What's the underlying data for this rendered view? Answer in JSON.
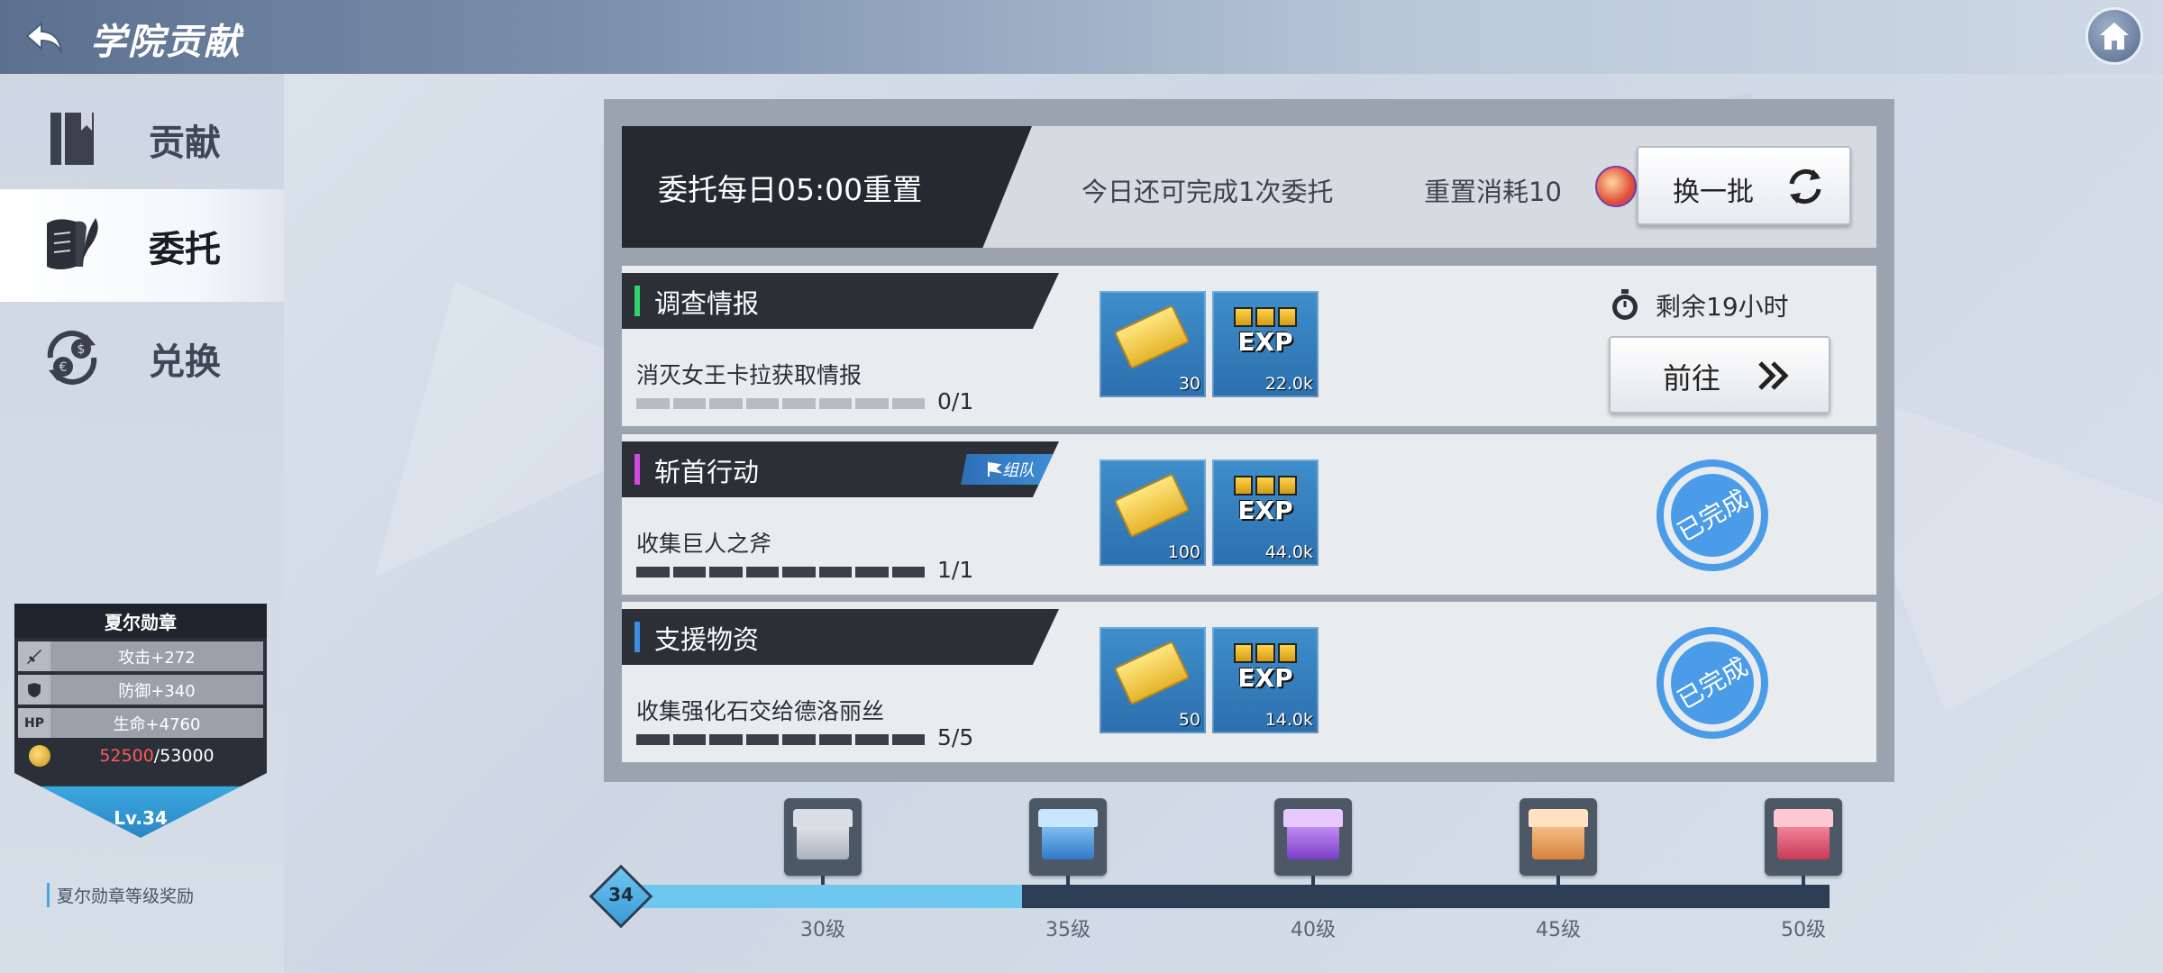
{
  "header": {
    "title": "学院贡献",
    "back_icon": "back-arrow-icon",
    "home_icon": "home-icon"
  },
  "sidebar": {
    "items": [
      {
        "label": "贡献",
        "icon": "book-icon",
        "active": false
      },
      {
        "label": "委托",
        "icon": "scroll-quill-icon",
        "active": true
      },
      {
        "label": "兑换",
        "icon": "currency-exchange-icon",
        "active": false
      }
    ]
  },
  "medal": {
    "title": "夏尔勋章",
    "stats": [
      {
        "icon": "sword-icon",
        "text": "攻击+272"
      },
      {
        "icon": "shield-icon",
        "text": "防御+340"
      },
      {
        "icon": "HP",
        "text": "生命+4760"
      }
    ],
    "coin_current": "52500",
    "coin_total": "/53000",
    "level": "Lv.34",
    "reward_link": "夏尔勋章等级奖励"
  },
  "commission": {
    "reset_text": "委托每日05:00重置",
    "remaining_text": "今日还可完成1次委托",
    "cost_text": "重置消耗10",
    "refresh_label": "换一批"
  },
  "tasks": [
    {
      "tag": "调查情报",
      "tag_color": "#2fd36a",
      "team": "",
      "desc": "消灭女王卡拉获取情报",
      "progress": "0/1",
      "progress_fraction": 0,
      "rewards": [
        {
          "type": "ticket",
          "count": "30"
        },
        {
          "type": "exp",
          "count": "22.0k"
        }
      ],
      "status": "active",
      "timer": "剩余19小时",
      "goto_label": "前往"
    },
    {
      "tag": "斩首行动",
      "tag_color": "#d04adf",
      "team": "组队",
      "desc": "收集巨人之斧",
      "progress": "1/1",
      "progress_fraction": 1,
      "rewards": [
        {
          "type": "ticket",
          "count": "100"
        },
        {
          "type": "exp",
          "count": "44.0k"
        }
      ],
      "status": "done",
      "done_label": "已完成"
    },
    {
      "tag": "支援物资",
      "tag_color": "#3a8fe0",
      "team": "",
      "desc": "收集强化石交给德洛丽丝",
      "progress": "5/5",
      "progress_fraction": 1,
      "rewards": [
        {
          "type": "ticket",
          "count": "50"
        },
        {
          "type": "exp",
          "count": "14.0k"
        }
      ],
      "status": "done",
      "done_label": "已完成"
    }
  ],
  "level_track": {
    "current_level": "34",
    "progress_fraction": 0.33,
    "milestones": [
      {
        "label": "30级",
        "chest": "silver"
      },
      {
        "label": "35级",
        "chest": "blue"
      },
      {
        "label": "40级",
        "chest": "purple"
      },
      {
        "label": "45级",
        "chest": "orange"
      },
      {
        "label": "50级",
        "chest": "red"
      }
    ]
  },
  "colors": {
    "accent_blue": "#6ec7ee",
    "stamp_blue": "#4a9be8",
    "progress_dark": "#3b3f47"
  }
}
